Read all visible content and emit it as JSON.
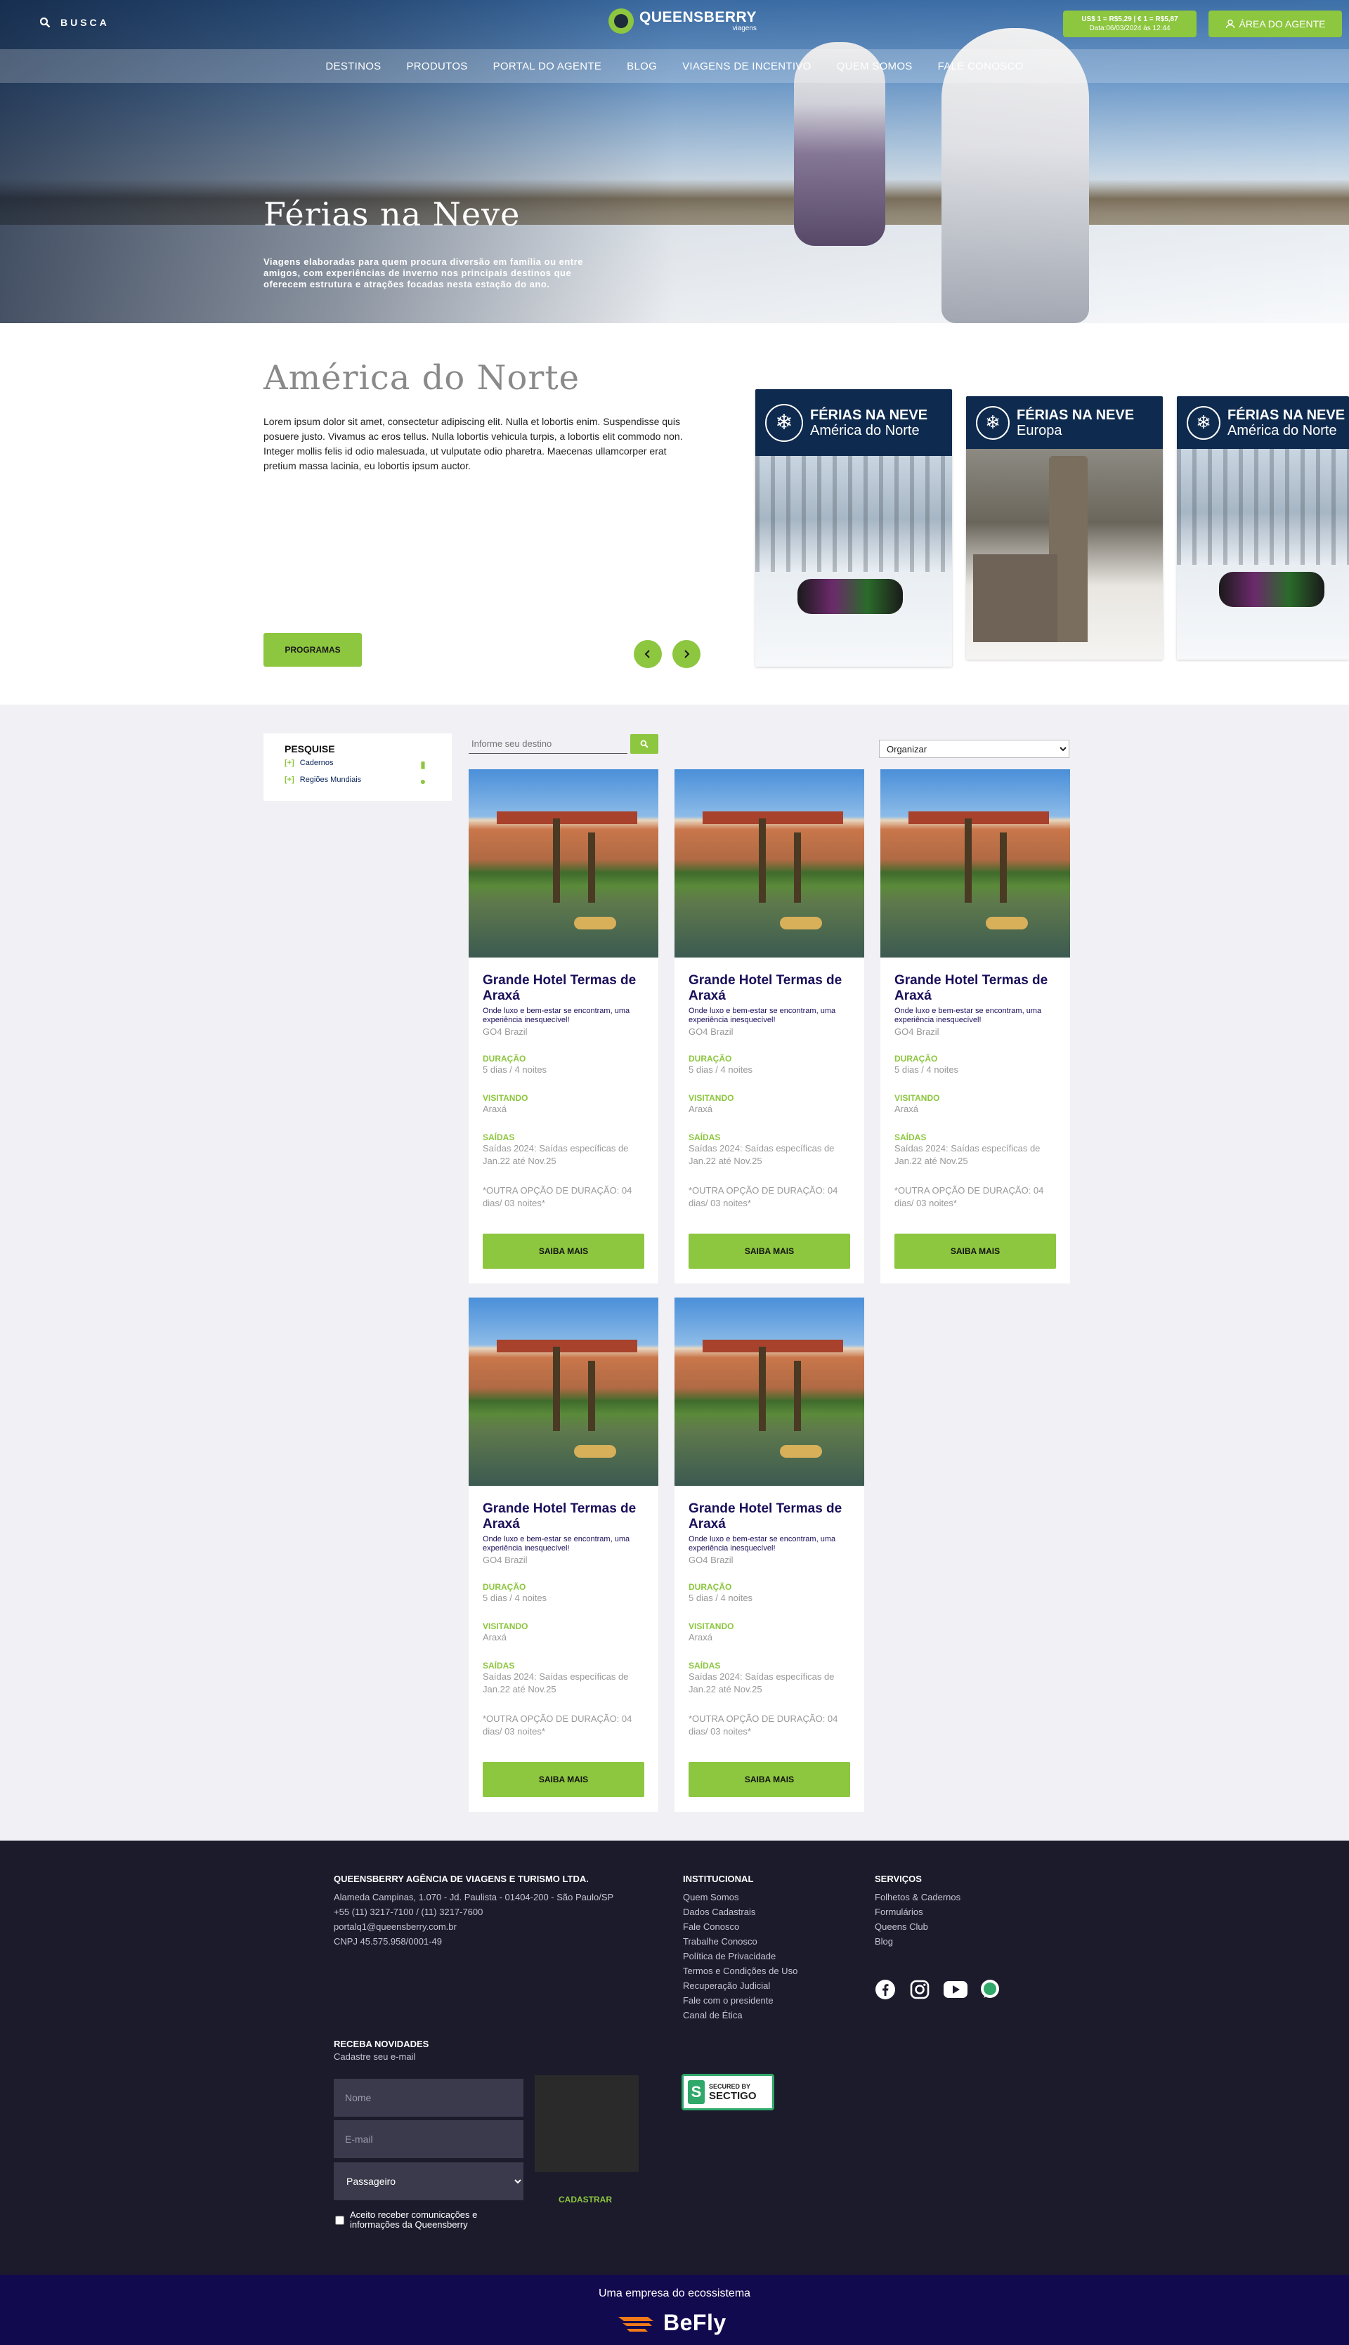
{
  "header": {
    "search_label": "BUSCA",
    "logo_title": "QUEENSBERRY",
    "logo_sub": "viagens",
    "rate_line1": "US$ 1 = R$5,29 | € 1 = R$5,87",
    "rate_line2": "Data:06/03/2024 às 12:44",
    "agent_label": "ÁREA DO AGENTE"
  },
  "nav": [
    "DESTINOS",
    "PRODUTOS",
    "PORTAL DO AGENTE",
    "BLOG",
    "VIAGENS DE INCENTIVO",
    "QUEM SOMOS",
    "FALE CONOSCO"
  ],
  "hero": {
    "title": "Férias na Neve",
    "subtitle": "Viagens elaboradas para quem procura diversão em família ou entre amigos, com experiências de inverno nos principais destinos que oferecem estrutura e atrações focadas nesta estação do ano."
  },
  "region": {
    "title": "América do Norte",
    "text": "Lorem ipsum dolor sit amet, consectetur adipiscing elit. Nulla et lobortis enim. Suspendisse quis posuere justo. Vivamus ac eros tellus. Nulla lobortis vehicula turpis, a lobortis elit commodo non. Integer mollis felis id odio malesuada, ut vulputate odio pharetra. Maecenas ullamcorper erat pretium massa lacinia, eu lobortis ipsum auctor.",
    "button": "PROGRAMAS",
    "promos": [
      {
        "l1": "FÉRIAS NA NEVE",
        "l2": "América do Norte"
      },
      {
        "l1": "FÉRIAS NA NEVE",
        "l2": "Europa"
      },
      {
        "l1": "FÉRIAS NA NEVE",
        "l2": "América do Norte"
      }
    ]
  },
  "filter": {
    "title": "PESQUISE",
    "items": [
      {
        "mark": "[+]",
        "label": "Cadernos"
      },
      {
        "mark": "[+]",
        "label": "Regiões Mundiais"
      }
    ],
    "search_placeholder": "Informe seu destino",
    "sort_value": "Organizar"
  },
  "cards": [
    {
      "title": "Grande Hotel Termas de Araxá",
      "tagline": "Onde luxo e bem-estar se encontram, uma experiência inesquecível!",
      "loc": "GO4 Brazil",
      "dur_label": "DURAÇÃO",
      "dur": "5 dias / 4 noites",
      "vis_label": "VISITANDO",
      "vis": "Araxá",
      "dep_label": "SAÍDAS",
      "dep": "Saídas 2024: Saídas específicas de Jan.22 até Nov.25",
      "note": "*OUTRA OPÇÃO DE DURAÇÃO: 04 dias/ 03 noites*",
      "button": "SAIBA MAIS"
    },
    {
      "title": "Grande Hotel Termas de Araxá",
      "tagline": "Onde luxo e bem-estar se encontram, uma experiência inesquecível!",
      "loc": "GO4 Brazil",
      "dur_label": "DURAÇÃO",
      "dur": "5 dias / 4 noites",
      "vis_label": "VISITANDO",
      "vis": "Araxá",
      "dep_label": "SAÍDAS",
      "dep": "Saídas 2024: Saídas específicas de Jan.22 até Nov.25",
      "note": "*OUTRA OPÇÃO DE DURAÇÃO: 04 dias/ 03 noites*",
      "button": "SAIBA MAIS"
    },
    {
      "title": "Grande Hotel Termas de Araxá",
      "tagline": "Onde luxo e bem-estar se encontram, uma experiência inesquecível!",
      "loc": "GO4 Brazil",
      "dur_label": "DURAÇÃO",
      "dur": "5 dias / 4 noites",
      "vis_label": "VISITANDO",
      "vis": "Araxá",
      "dep_label": "SAÍDAS",
      "dep": "Saídas 2024: Saídas específicas de Jan.22 até Nov.25",
      "note": "*OUTRA OPÇÃO DE DURAÇÃO: 04 dias/ 03 noites*",
      "button": "SAIBA MAIS"
    },
    {
      "title": "Grande Hotel Termas de Araxá",
      "tagline": "Onde luxo e bem-estar se encontram, uma experiência inesquecível!",
      "loc": "GO4 Brazil",
      "dur_label": "DURAÇÃO",
      "dur": "5 dias / 4 noites",
      "vis_label": "VISITANDO",
      "vis": "Araxá",
      "dep_label": "SAÍDAS",
      "dep": "Saídas 2024: Saídas específicas de Jan.22 até Nov.25",
      "note": "*OUTRA OPÇÃO DE DURAÇÃO: 04 dias/ 03 noites*",
      "button": "SAIBA MAIS"
    },
    {
      "title": "Grande Hotel Termas de Araxá",
      "tagline": "Onde luxo e bem-estar se encontram, uma experiência inesquecível!",
      "loc": "GO4 Brazil",
      "dur_label": "DURAÇÃO",
      "dur": "5 dias / 4 noites",
      "vis_label": "VISITANDO",
      "vis": "Araxá",
      "dep_label": "SAÍDAS",
      "dep": "Saídas 2024: Saídas específicas de Jan.22 até Nov.25",
      "note": "*OUTRA OPÇÃO DE DURAÇÃO: 04 dias/ 03 noites*",
      "button": "SAIBA MAIS"
    }
  ],
  "footer": {
    "company": "QUEENSBERRY AGÊNCIA DE VIAGENS E TURISMO LTDA.",
    "address": "Alameda Campinas, 1.070 - Jd. Paulista - 01404-200 - São Paulo/SP",
    "phone": "+55 (11) 3217-7100 / (11) 3217-7600",
    "email": "portalq1@queensberry.com.br",
    "cnpj": "CNPJ 45.575.958/0001-49",
    "inst_title": "INSTITUCIONAL",
    "inst_links": [
      "Quem Somos",
      "Dados Cadastrais",
      "Fale Conosco",
      "Trabalhe Conosco",
      "Política de Privacidade",
      "Termos e Condições de Uso",
      "Recuperação Judicial",
      "Fale com o presidente",
      "Canal de Ética"
    ],
    "serv_title": "SERVIÇOS",
    "serv_links": [
      "Folhetos & Cadernos",
      "Formulários",
      "Queens Club",
      "Blog"
    ],
    "news_title": "RECEBA NOVIDADES",
    "news_sub": "Cadastre seu e-mail",
    "name_placeholder": "Nome",
    "email_placeholder": "E-mail",
    "profile_value": "Passageiro",
    "consent": "Aceito receber comunicações e informações da Queensberry",
    "subscribe": "CADASTRAR",
    "sectigo_top": "SECURED BY",
    "sectigo_brand": "SECTIGO"
  },
  "bottom": {
    "eco": "Uma empresa do ecossistema",
    "brand": "BeFly"
  },
  "colors": {
    "accent": "#8dc63f",
    "navy": "#1a0f5a",
    "footer": "#1b1b2c",
    "bottom": "#120a4e"
  }
}
